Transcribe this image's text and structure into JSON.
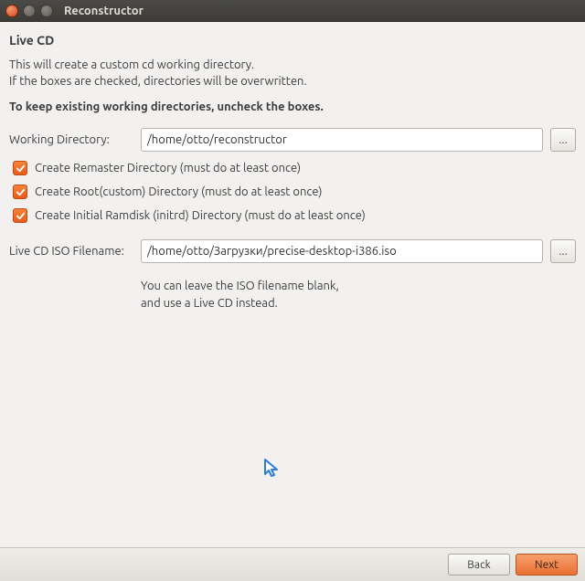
{
  "window": {
    "title": "Reconstructor"
  },
  "heading": "Live CD",
  "description_line1": "This will create a custom cd working directory.",
  "description_line2": "If the boxes are checked, directories will be overwritten.",
  "keep_note": "To keep existing working directories, uncheck the boxes.",
  "working_dir": {
    "label": "Working Directory:",
    "value": "/home/otto/reconstructor",
    "browse": "..."
  },
  "checkboxes": {
    "remaster": "Create Remaster Directory (must do at least once)",
    "root": "Create Root(custom) Directory (must do at least once)",
    "initrd": "Create Initial Ramdisk (initrd) Directory (must do at least once)"
  },
  "iso": {
    "label": "Live CD ISO Filename:",
    "value": "/home/otto/Загрузки/precise-desktop-i386.iso",
    "browse": "...",
    "hint_line1": "You can leave the ISO filename blank,",
    "hint_line2": "and use a Live CD instead."
  },
  "footer": {
    "back": "Back",
    "next": "Next"
  }
}
